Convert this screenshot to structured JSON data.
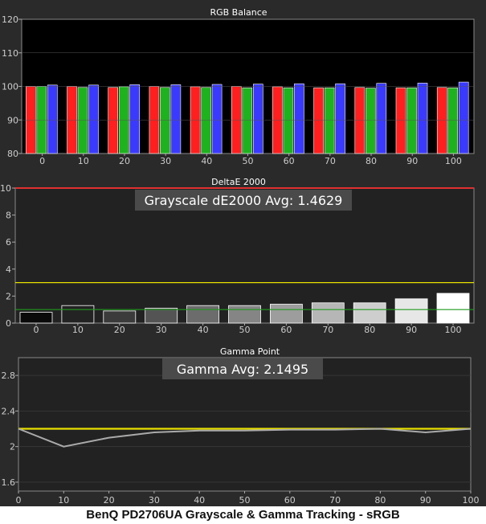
{
  "caption": "BenQ PD2706UA Grayscale & Gamma Tracking - sRGB",
  "colors": {
    "red": "#ff1f1f",
    "green": "#1fb21f",
    "blue": "#3a3aff",
    "reference_line": "#e8e000",
    "threshold_green": "#1f9a1f",
    "top_line": "#e03030",
    "gamma_measured": "#aaaaaa"
  },
  "chart_data": [
    {
      "type": "bar",
      "title": "RGB Balance",
      "categories": [
        "0",
        "10",
        "20",
        "30",
        "40",
        "50",
        "60",
        "70",
        "80",
        "90",
        "100"
      ],
      "ylim": [
        80,
        120
      ],
      "yticks": [
        "80",
        "90",
        "100",
        "110",
        "120"
      ],
      "series": [
        {
          "color": "red",
          "values": [
            100.0,
            100.0,
            99.7,
            100.0,
            99.9,
            100.0,
            99.9,
            99.6,
            99.7,
            99.6,
            99.7
          ]
        },
        {
          "color": "green",
          "values": [
            100.0,
            99.7,
            99.9,
            99.7,
            99.7,
            99.6,
            99.6,
            99.6,
            99.5,
            99.6,
            99.6
          ]
        },
        {
          "color": "blue",
          "values": [
            100.4,
            100.4,
            100.5,
            100.5,
            100.6,
            100.7,
            100.8,
            100.8,
            100.9,
            101.0,
            101.3
          ]
        }
      ]
    },
    {
      "type": "bar",
      "title": "DeltaE 2000",
      "annotation": "Grayscale dE2000 Avg: 1.4629",
      "categories": [
        "0",
        "10",
        "20",
        "30",
        "40",
        "50",
        "60",
        "70",
        "80",
        "90",
        "100"
      ],
      "ylim": [
        0,
        10
      ],
      "yticks": [
        "0",
        "2",
        "4",
        "6",
        "8",
        "10"
      ],
      "values": [
        0.8,
        1.3,
        0.9,
        1.1,
        1.3,
        1.3,
        1.4,
        1.5,
        1.5,
        1.8,
        2.2
      ],
      "reference_lines": [
        3,
        1
      ]
    },
    {
      "type": "line",
      "title": "Gamma Point",
      "annotation": "Gamma Avg: 2.1495",
      "x": [
        0,
        10,
        20,
        30,
        40,
        50,
        60,
        70,
        80,
        90,
        100
      ],
      "xticks": [
        "0",
        "10",
        "20",
        "30",
        "40",
        "50",
        "60",
        "70",
        "80",
        "90",
        "100"
      ],
      "ylim": [
        1.5,
        3.0
      ],
      "yticks": [
        "1.6",
        "2",
        "2.4",
        "2.8"
      ],
      "target": 2.2,
      "values": [
        2.2,
        2.0,
        2.1,
        2.16,
        2.18,
        2.18,
        2.19,
        2.19,
        2.2,
        2.16,
        2.2
      ]
    }
  ]
}
